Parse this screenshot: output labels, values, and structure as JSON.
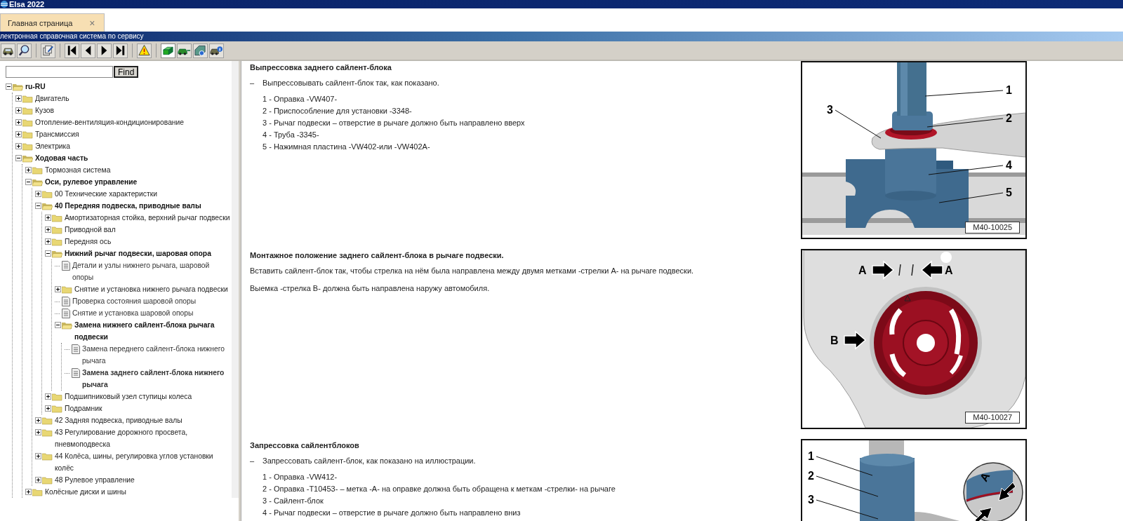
{
  "window": {
    "title": "Elsa 2022"
  },
  "tabs": [
    {
      "label": "Главная страница",
      "close": "×",
      "selected": true
    }
  ],
  "banner": {
    "title": "лектронная справочная система по сервису"
  },
  "toolbar": {
    "buttons": [
      {
        "kind": "car",
        "pressed": false
      },
      {
        "kind": "search",
        "pressed": false
      },
      {
        "kind": "separator"
      },
      {
        "kind": "edit",
        "pressed": false
      },
      {
        "kind": "separator"
      },
      {
        "kind": "first",
        "pressed": false
      },
      {
        "kind": "previous",
        "pressed": false
      },
      {
        "kind": "next",
        "pressed": false
      },
      {
        "kind": "last",
        "pressed": false
      },
      {
        "kind": "separator"
      },
      {
        "kind": "warning",
        "pressed": false
      },
      {
        "kind": "separator"
      },
      {
        "kind": "block",
        "pressed": true
      },
      {
        "kind": "car_arrow",
        "pressed": false
      },
      {
        "kind": "car_gear",
        "pressed": false
      },
      {
        "kind": "car_info",
        "pressed": false
      }
    ]
  },
  "search": {
    "button": "Find"
  },
  "tree": [
    {
      "label": "ru-RU",
      "kind": "folder",
      "expanded": true,
      "children": [
        {
          "label": "Двигатель",
          "kind": "folder",
          "expanded": false
        },
        {
          "label": "Кузов",
          "kind": "folder",
          "expanded": false
        },
        {
          "label": "Отопление-вентиляция-кондиционирование",
          "kind": "folder",
          "expanded": false
        },
        {
          "label": "Трансмиссия",
          "kind": "folder",
          "expanded": false
        },
        {
          "label": "Электрика",
          "kind": "folder",
          "expanded": false
        },
        {
          "label": "Ходовая часть",
          "kind": "folder",
          "expanded": true,
          "children": [
            {
              "label": "Тормозная система",
              "kind": "folder",
              "expanded": false
            },
            {
              "label": "Оси, рулевое управление",
              "kind": "folder",
              "expanded": true,
              "children": [
                {
                  "label": "00 Технические характеристки",
                  "kind": "folder",
                  "expanded": false
                },
                {
                  "label": "40 Передняя подвеска, приводные валы",
                  "kind": "folder",
                  "expanded": true,
                  "children": [
                    {
                      "label": "Амортизаторная стойка, верхний рычаг подвески",
                      "kind": "folder",
                      "expanded": false
                    },
                    {
                      "label": "Приводной вал",
                      "kind": "folder",
                      "expanded": false
                    },
                    {
                      "label": "Передняя ось",
                      "kind": "folder",
                      "expanded": false
                    },
                    {
                      "label": "Нижний рычаг подвески, шаровая опора",
                      "kind": "folder",
                      "expanded": true,
                      "children": [
                        {
                          "label": "Детали и узлы нижнего рычага, шаровой опоры",
                          "kind": "document",
                          "selected": false
                        },
                        {
                          "label": "Снятие и установка нижнего рычага подвески",
                          "kind": "folder",
                          "expanded": false
                        },
                        {
                          "label": "Проверка состояния шаровой опоры",
                          "kind": "document",
                          "selected": false
                        },
                        {
                          "label": "Снятие и установка шаровой опоры",
                          "kind": "document",
                          "selected": false
                        },
                        {
                          "label": "Замена нижнего сайлент-блока рычага подвески",
                          "kind": "folder",
                          "expanded": true,
                          "children": [
                            {
                              "label": "Замена переднего сайлент-блока нижнего рычага",
                              "kind": "document",
                              "selected": false
                            },
                            {
                              "label": "Замена заднего сайлент-блока нижнего рычага",
                              "kind": "document",
                              "selected": true
                            }
                          ]
                        }
                      ]
                    },
                    {
                      "label": "Подшипниковый узел ступицы колеса",
                      "kind": "folder",
                      "expanded": false
                    },
                    {
                      "label": "Подрамник",
                      "kind": "folder",
                      "expanded": false
                    }
                  ]
                },
                {
                  "label": "42 Задняя подвеска, приводные валы",
                  "kind": "folder",
                  "expanded": false
                },
                {
                  "label": "43 Регулирование дорожного просвета, пневмоподвеска",
                  "kind": "folder",
                  "expanded": false
                },
                {
                  "label": "44 Колёса, шины, регулировка углов установки колёс",
                  "kind": "folder",
                  "expanded": false
                },
                {
                  "label": "48 Рулевое управление",
                  "kind": "folder",
                  "expanded": false
                }
              ]
            },
            {
              "label": "Колёсные диски и шины",
              "kind": "folder",
              "expanded": false
            }
          ]
        }
      ]
    }
  ],
  "sections": [
    {
      "heading": "Выпрессовка заднего сайлент-блока",
      "items": [
        {
          "kind": "step",
          "marker": "–",
          "text": "Выпрессовывать сайлент-блок так, как показано."
        },
        {
          "kind": "list",
          "text": "1 - Оправка -VW407-"
        },
        {
          "kind": "list",
          "text": "2 - Приспособление для установки -3348-"
        },
        {
          "kind": "list",
          "text": "3 - Рычаг подвески – отверстие в рычаге должно быть направлено вверх"
        },
        {
          "kind": "list",
          "text": "4 - Труба -3345-"
        },
        {
          "kind": "list",
          "text": "5 - Нажимная пластина -VW402-или -VW402A-"
        }
      ],
      "figure": {
        "kind": "press_out",
        "callouts": [
          "1",
          "2",
          "3",
          "4",
          "5"
        ],
        "code": "M40-10025"
      }
    },
    {
      "heading": "Монтажное положение заднего сайлент-блока в рычаге подвески.",
      "items": [
        {
          "kind": "para",
          "text": "Вставить сайлент-блок так, чтобы стрелка на нём была направлена между двумя метками -стрелки A- на рычаге подвески."
        },
        {
          "kind": "para",
          "text": "Выемка -стрелка B- должна быть направлена наружу автомобиля."
        }
      ],
      "figure": {
        "kind": "position",
        "callouts": [
          "A",
          "A",
          "B"
        ],
        "code": "M40-10027"
      }
    },
    {
      "heading": "Запрессовка сайлентблоков",
      "items": [
        {
          "kind": "step",
          "marker": "–",
          "text": "Запрессовать сайлент-блок, как показано на иллюстрации."
        },
        {
          "kind": "list",
          "text": "1 - Оправка -VW412-"
        },
        {
          "kind": "list",
          "text": "2 - Оправка -T10453- – метка -A- на оправке должна быть обращена к меткам -стрелки- на рычаге"
        },
        {
          "kind": "list",
          "text": "3 - Сайлент-блок"
        },
        {
          "kind": "list",
          "text": "4 - Рычаг подвески – отверстие в рычаге должно быть направлено вниз"
        }
      ],
      "figure": {
        "kind": "press_in",
        "callouts": [
          "1",
          "2",
          "3",
          "A"
        ]
      }
    }
  ]
}
